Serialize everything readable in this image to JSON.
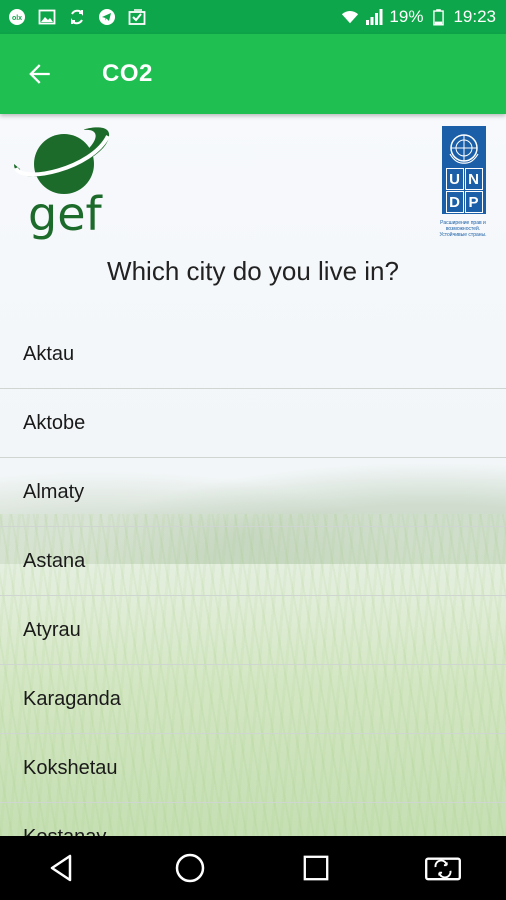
{
  "status_bar": {
    "battery": "19%",
    "time": "19:23",
    "left_icons": [
      "olx-icon",
      "image-icon",
      "sync-icon",
      "telegram-icon",
      "inbox-icon"
    ],
    "right_icons": [
      "wifi-icon",
      "signal-icon",
      "battery-icon"
    ]
  },
  "app_bar": {
    "title": "CO2",
    "back_icon": "arrow-left-icon"
  },
  "logos": {
    "gef_text": "gef",
    "undp_letters": [
      "U",
      "N",
      "D",
      "P"
    ],
    "undp_caption": "Расширение прав и возможностей. Устойчивые страны."
  },
  "question": "Which city do you live in?",
  "cities": [
    "Aktau",
    "Aktobe",
    "Almaty",
    "Astana",
    "Atyrau",
    "Karaganda",
    "Kokshetau",
    "Kostanay"
  ],
  "nav_bar": {
    "icons": [
      "back-icon",
      "home-icon",
      "recents-icon",
      "screen-rotate-icon"
    ]
  },
  "colors": {
    "status_bar": "#0ea64a",
    "app_bar": "#1fbf52",
    "gef_green": "#1d6b2b",
    "undp_blue": "#1b5fa8"
  }
}
